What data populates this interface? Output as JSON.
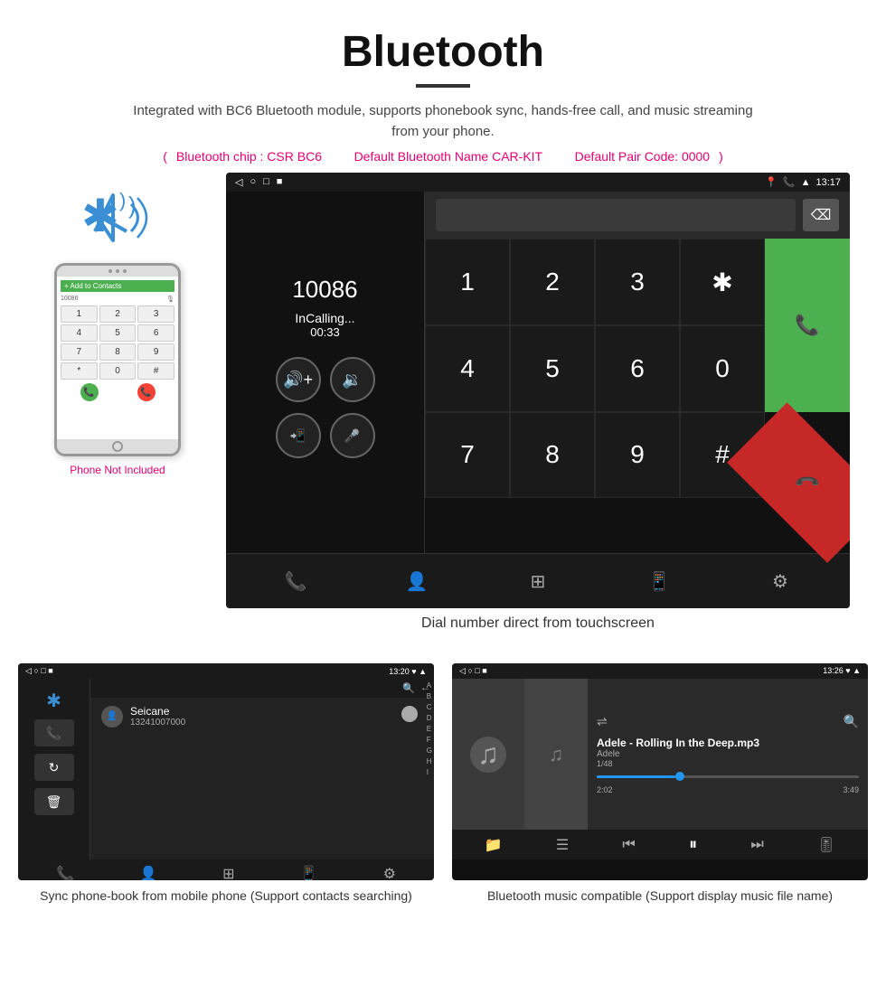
{
  "header": {
    "title": "Bluetooth",
    "subtitle": "Integrated with BC6 Bluetooth module, supports phonebook sync, hands-free call, and music streaming from your phone.",
    "specs": {
      "chip": "Bluetooth chip : CSR BC6",
      "name": "Default Bluetooth Name CAR-KIT",
      "code": "Default Pair Code: 0000"
    }
  },
  "dial_screen": {
    "status": {
      "left_icons": [
        "◁",
        "○",
        "□",
        "▪"
      ],
      "right_icons": [
        "♥",
        "📞",
        "▲",
        "13:17"
      ]
    },
    "call": {
      "number": "10086",
      "status": "InCalling...",
      "timer": "00:33"
    },
    "keypad": {
      "keys": [
        "1",
        "2",
        "3",
        "✱",
        "4",
        "5",
        "6",
        "0",
        "7",
        "8",
        "9",
        "#"
      ],
      "call_icon": "📞",
      "end_icon": "📞"
    },
    "caption": "Dial number direct from touchscreen"
  },
  "phonebook_screen": {
    "status": {
      "left_icons": [
        "◁",
        "○",
        "□",
        "▪"
      ],
      "time": "13:20",
      "right_icons": [
        "♥",
        "▲"
      ]
    },
    "contact": {
      "name": "Seicane",
      "number": "13241007000"
    },
    "caption": "Sync phone-book from mobile phone\n(Support contacts searching)"
  },
  "music_screen": {
    "status": {
      "left_icons": [
        "◁",
        "○",
        "□",
        "▪"
      ],
      "time": "13:26",
      "right_icons": [
        "♥",
        "▲"
      ]
    },
    "track": {
      "title": "Adele - Rolling In the Deep.mp3",
      "artist": "Adele",
      "current": "1/48",
      "time_current": "2:02",
      "time_total": "3:49",
      "progress_pct": 30
    },
    "caption": "Bluetooth music compatible\n(Support display music file name)"
  },
  "phone_mockup": {
    "label": "Phone Not Included",
    "number": "10086",
    "keys": [
      "1",
      "2",
      "3",
      "4",
      "5",
      "6",
      "7",
      "8",
      "9",
      "*",
      "0",
      "#"
    ]
  }
}
